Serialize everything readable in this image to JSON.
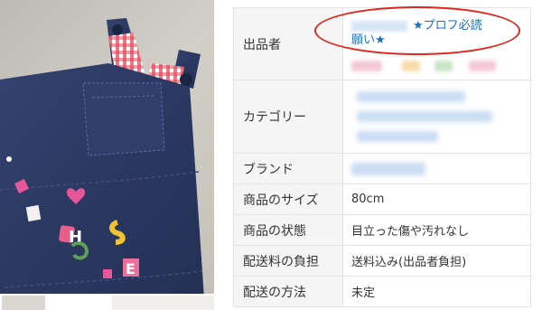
{
  "seller_row": {
    "label": "出品者",
    "bio_line1": "★プロフ必読",
    "bio_line2": "願い★"
  },
  "category_row": {
    "label": "カテゴリー"
  },
  "brand_row": {
    "label": "ブランド"
  },
  "size_row": {
    "label": "商品のサイズ",
    "value": "80cm"
  },
  "condition_row": {
    "label": "商品の状態",
    "value": "目立った傷や汚れなし"
  },
  "shipping_fee_row": {
    "label": "配送料の負担",
    "value": "送料込み(出品者負担)"
  },
  "shipping_method_row": {
    "label": "配送の方法",
    "value": "未定"
  },
  "photo": {
    "applique_letters": [
      "H",
      "S",
      "E"
    ]
  },
  "colors": {
    "link_blue": "#1f6fbf",
    "annotation_red": "#e0261d",
    "header_bg": "#f5f5f5",
    "denim": "#2c3a63"
  }
}
